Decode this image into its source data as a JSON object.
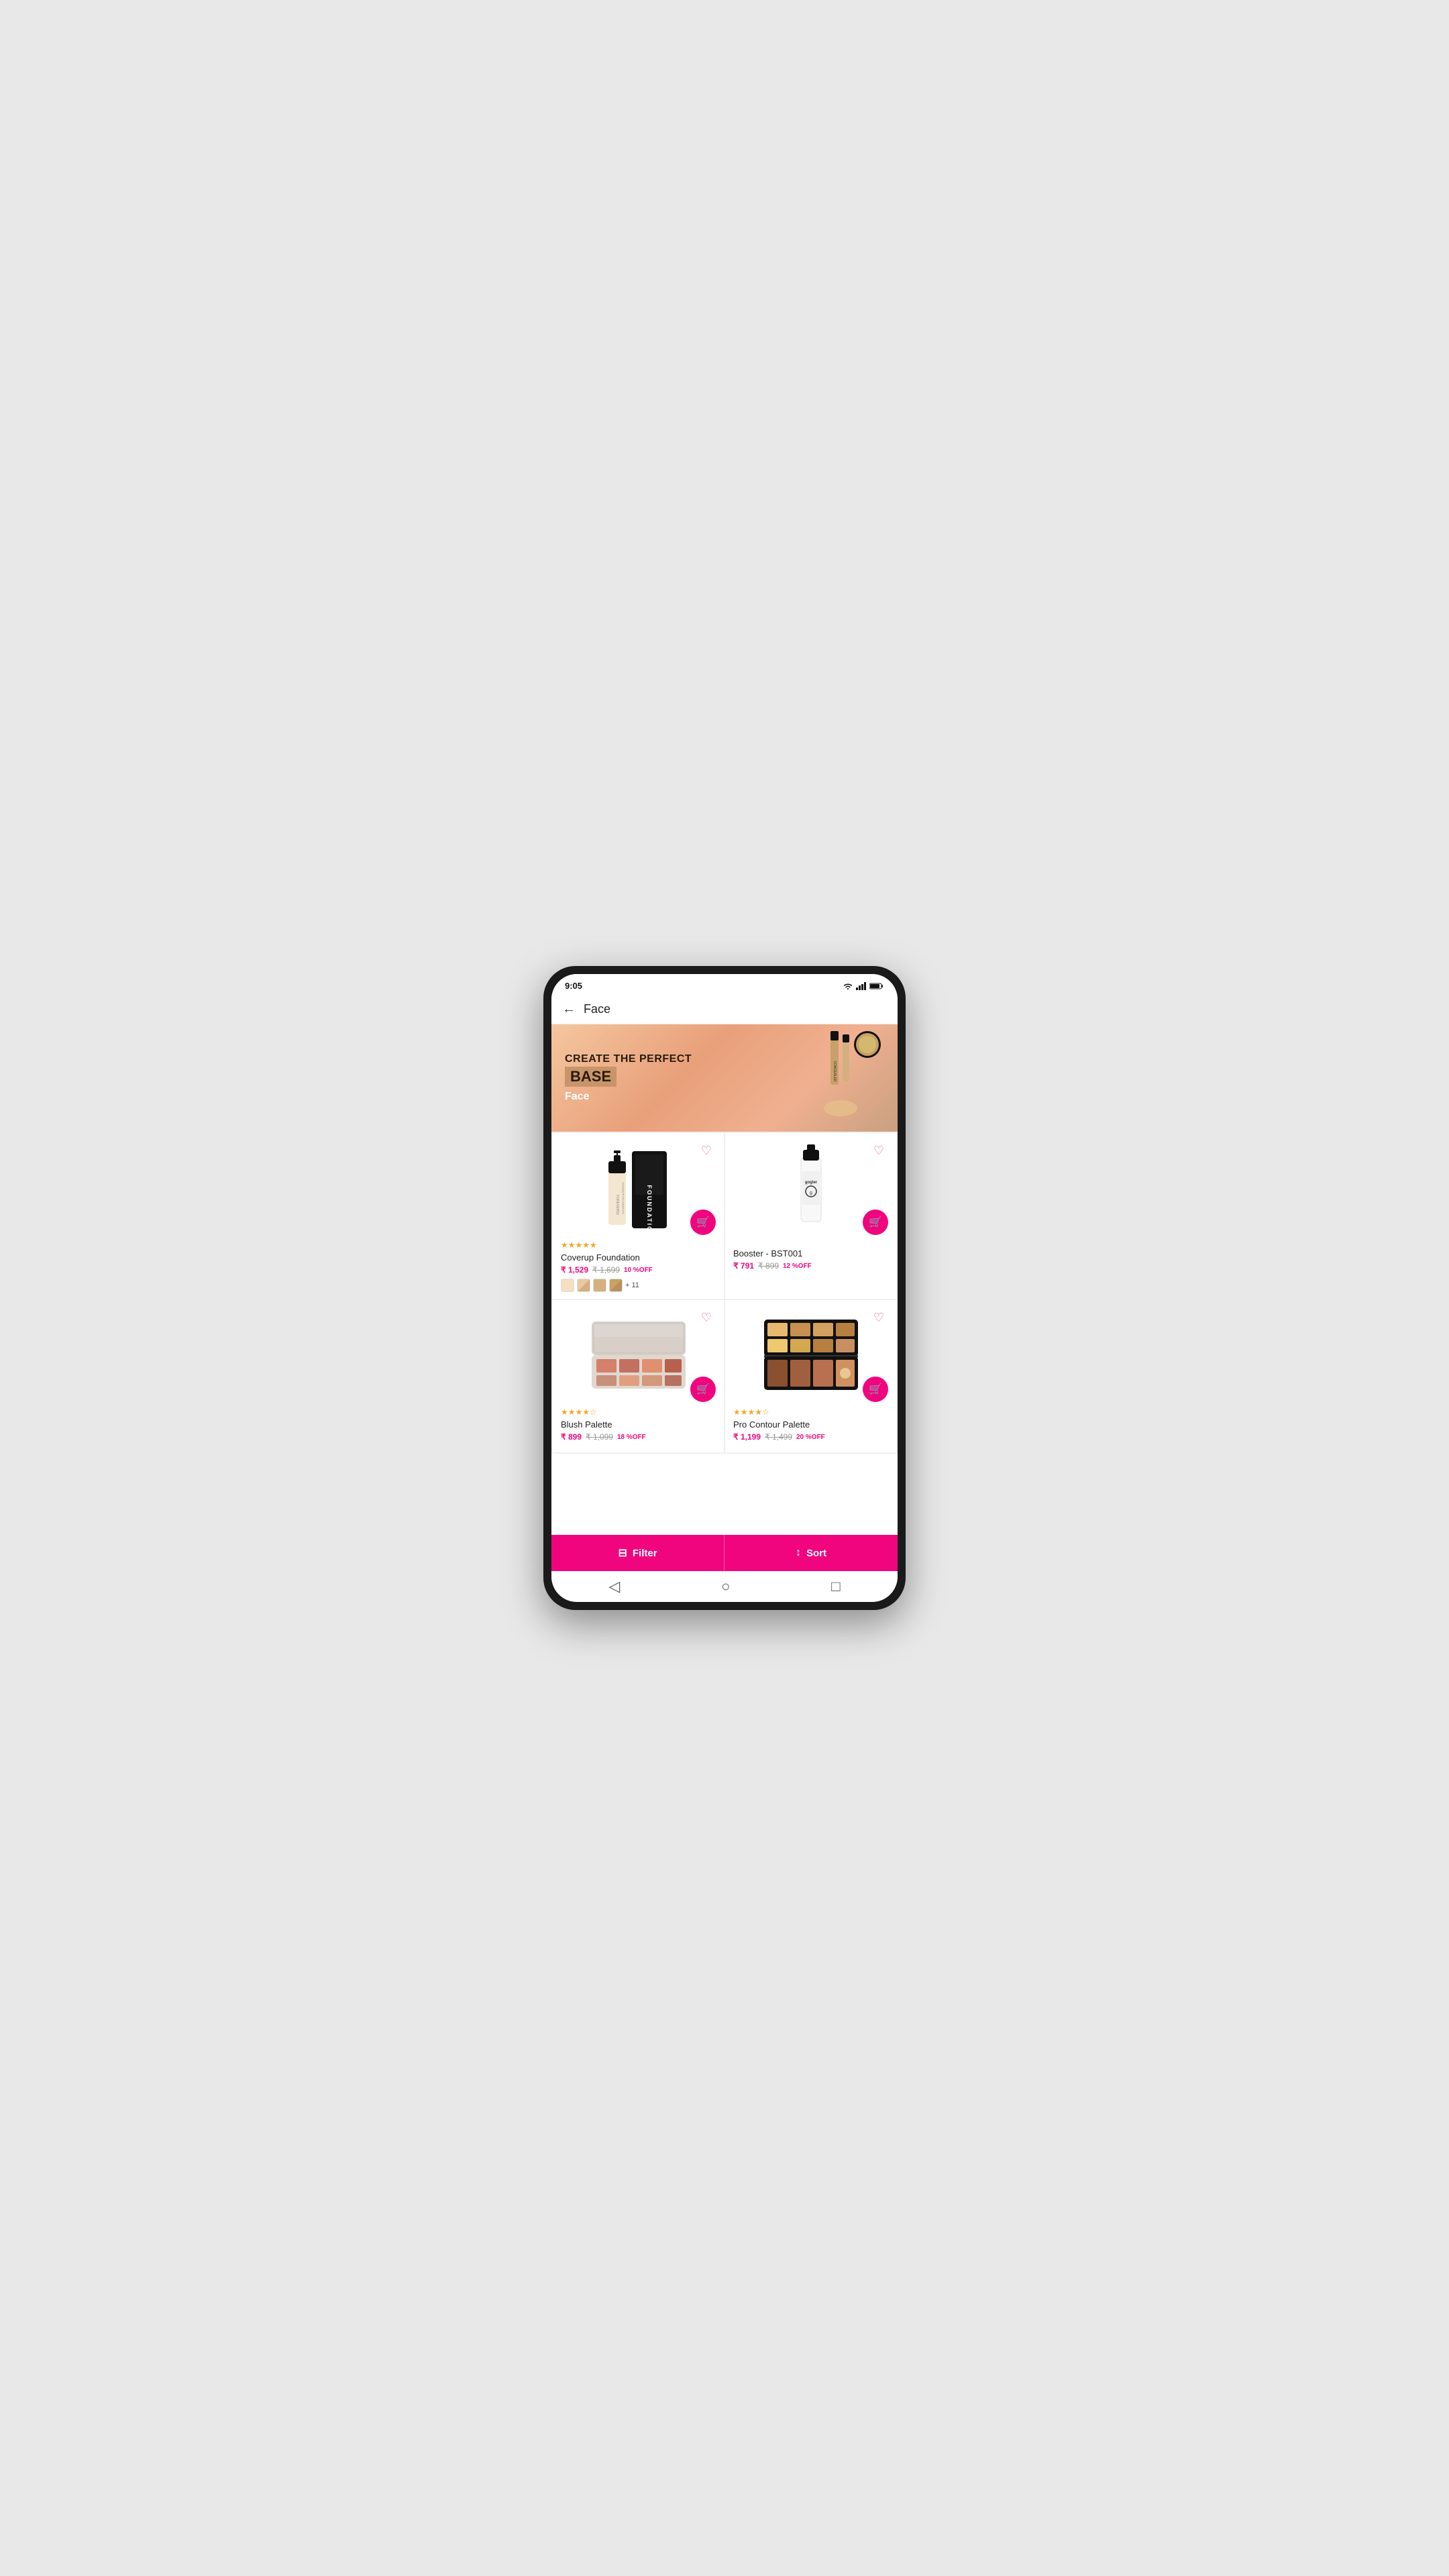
{
  "status": {
    "time": "9:05",
    "wifi": "▲",
    "signal": "▲",
    "battery": "▌"
  },
  "header": {
    "back_label": "←",
    "title": "Face"
  },
  "banner": {
    "line1": "CREATE THE PERFECT",
    "line2": "BASE",
    "category_label": "Face"
  },
  "products": [
    {
      "name": "Coverup Foundation",
      "price_current": "₹ 1,529",
      "price_original": "₹ 1,699",
      "discount": "10 %OFF",
      "stars": 5,
      "has_colors": true,
      "more_colors": "+ 11",
      "swatches": [
        "#f5dfc0",
        "#e8c9a0",
        "#d4b080",
        "#b89060"
      ]
    },
    {
      "name": "Booster - BST001",
      "price_current": "₹ 791",
      "price_original": "₹ 899",
      "discount": "12 %OFF",
      "stars": 0,
      "has_colors": false
    },
    {
      "name": "Blush Palette",
      "price_current": "₹ 899",
      "price_original": "₹ 1,099",
      "discount": "18 %OFF",
      "stars": 4,
      "has_colors": false
    },
    {
      "name": "Pro Contour Palette",
      "price_current": "₹ 1,199",
      "price_original": "₹ 1,499",
      "discount": "20 %OFF",
      "stars": 4,
      "has_colors": false
    }
  ],
  "bottom_bar": {
    "filter_label": "Filter",
    "sort_label": "Sort"
  },
  "palette_swatches": {
    "blush": [
      "#d4806a",
      "#c47060",
      "#e09070",
      "#b86050",
      "#c8907a",
      "#e0a080",
      "#d4987a",
      "#b87060"
    ],
    "contour_top": [
      "#e8b870",
      "#c89050",
      "#d4a060",
      "#b88040",
      "#f0c870",
      "#d4a850",
      "#b88040",
      "#c89060"
    ],
    "contour_bottom": [
      "#8a5030",
      "#a06040",
      "#b87050",
      "#d09060"
    ]
  }
}
